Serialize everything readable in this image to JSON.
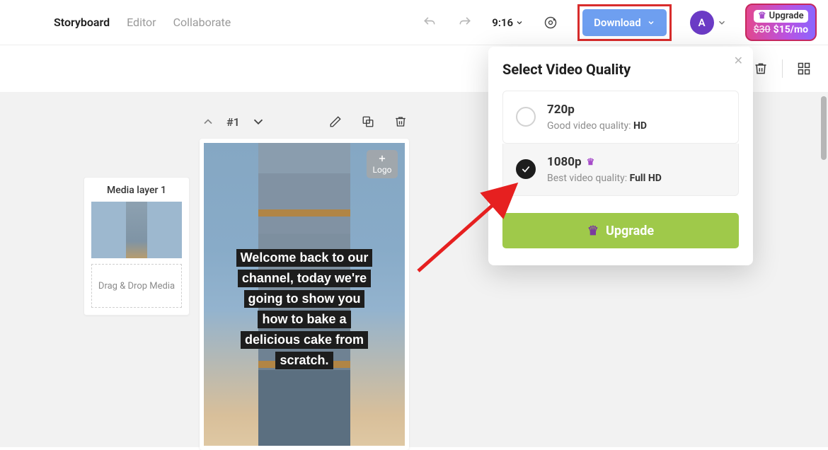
{
  "header": {
    "tabs": [
      "Storyboard",
      "Editor",
      "Collaborate"
    ],
    "active_tab": 0,
    "time": "9:16",
    "download_label": "Download",
    "avatar_initial": "A"
  },
  "upgrade_badge": {
    "label": "Upgrade",
    "old_price": "$30",
    "new_price": "$15/mo"
  },
  "media_panel": {
    "title": "Media layer 1",
    "drop_hint": "Drag & Drop Media"
  },
  "scene": {
    "index_label": "#1",
    "logo_label": "Logo",
    "caption_lines": [
      "Welcome back to our",
      "channel, today we're",
      "going to show you",
      "how to bake a",
      "delicious cake from",
      "scratch."
    ]
  },
  "popover": {
    "title": "Select Video Quality",
    "options": [
      {
        "title": "720p",
        "sub_prefix": "Good video quality: ",
        "sub_bold": "HD",
        "selected": false,
        "premium": false
      },
      {
        "title": "1080p",
        "sub_prefix": "Best video quality: ",
        "sub_bold": "Full HD",
        "selected": true,
        "premium": true
      }
    ],
    "upgrade_label": "Upgrade"
  }
}
